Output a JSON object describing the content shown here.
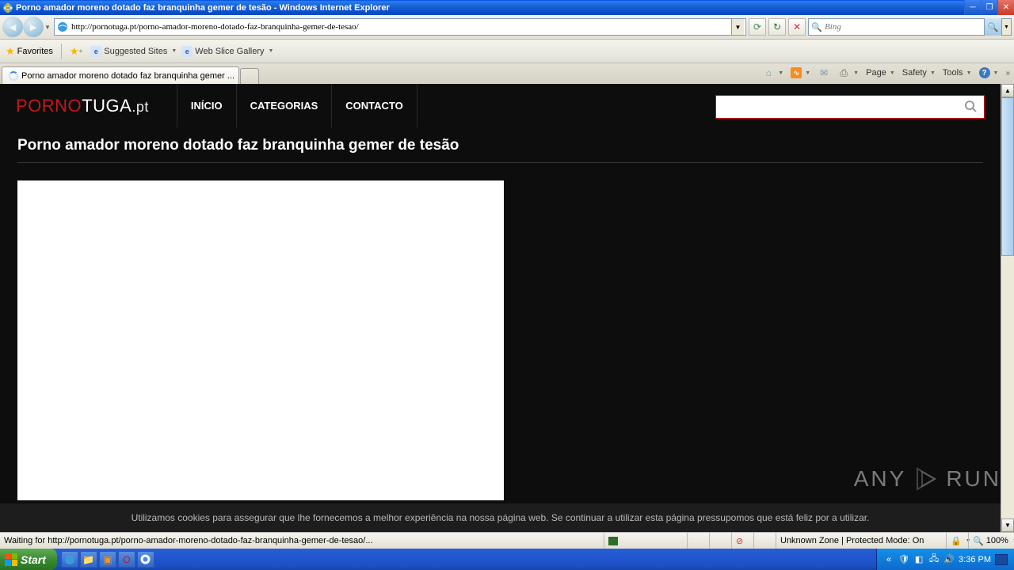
{
  "window": {
    "title": "Porno amador moreno dotado faz branquinha gemer de tesão - Windows Internet Explorer"
  },
  "nav": {
    "url": "http://pornotuga.pt/porno-amador-moreno-dotado-faz-branquinha-gemer-de-tesao/",
    "search_placeholder": "Bing"
  },
  "favbar": {
    "favorites": "Favorites",
    "suggested": "Suggested Sites",
    "webslice": "Web Slice Gallery"
  },
  "tab": {
    "title": "Porno amador moreno dotado faz branquinha gemer ..."
  },
  "cmdbar": {
    "page": "Page",
    "safety": "Safety",
    "tools": "Tools"
  },
  "site": {
    "logo_a": "PORNO",
    "logo_b": "TUGA",
    "logo_c": ".pt",
    "nav": {
      "inicio": "INÍCIO",
      "categorias": "CATEGORIAS",
      "contacto": "CONTACTO"
    },
    "title": "Porno amador moreno dotado faz branquinha gemer de tesão",
    "cookie": "Utilizamos cookies para assegurar que lhe fornecemos a melhor experiência na nossa página web. Se continuar a utilizar esta página pressupomos que está feliz por a utilizar."
  },
  "status": {
    "text": "Waiting for http://pornotuga.pt/porno-amador-moreno-dotado-faz-branquinha-gemer-de-tesao/...",
    "zone": "Unknown Zone | Protected Mode: On",
    "zoom": "100%"
  },
  "taskbar": {
    "start": "Start",
    "time": "3:36 PM"
  },
  "watermark": {
    "a": "ANY",
    "b": "RUN"
  }
}
